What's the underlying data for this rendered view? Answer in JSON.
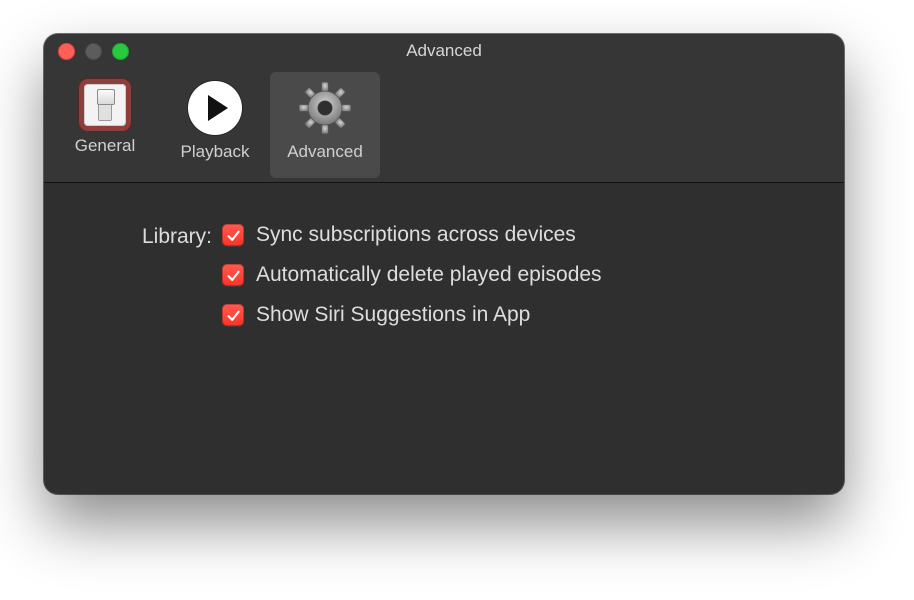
{
  "window": {
    "title": "Advanced"
  },
  "toolbar": {
    "tabs": [
      {
        "id": "general",
        "label": "General",
        "icon": "switch-icon",
        "active": false
      },
      {
        "id": "playback",
        "label": "Playback",
        "icon": "play-icon",
        "active": false
      },
      {
        "id": "advanced",
        "label": "Advanced",
        "icon": "gear-icon",
        "active": true
      }
    ]
  },
  "content": {
    "section_label": "Library:",
    "options": [
      {
        "id": "sync_subscriptions",
        "label": "Sync subscriptions across devices",
        "checked": true
      },
      {
        "id": "auto_delete",
        "label": "Automatically delete played episodes",
        "checked": true
      },
      {
        "id": "siri_suggestions",
        "label": "Show Siri Suggestions in App",
        "checked": true
      }
    ]
  },
  "traffic_lights": {
    "close": {
      "enabled": true,
      "color": "#ff5f57"
    },
    "minimize": {
      "enabled": false,
      "color": "#5c5c5c"
    },
    "zoom": {
      "enabled": true,
      "color": "#28c840"
    }
  },
  "colors": {
    "window_bg": "#2f2f2f",
    "toolbar_bg": "#363636",
    "text": "#dcdcdc",
    "checkbox_accent": "#ff3b30"
  }
}
